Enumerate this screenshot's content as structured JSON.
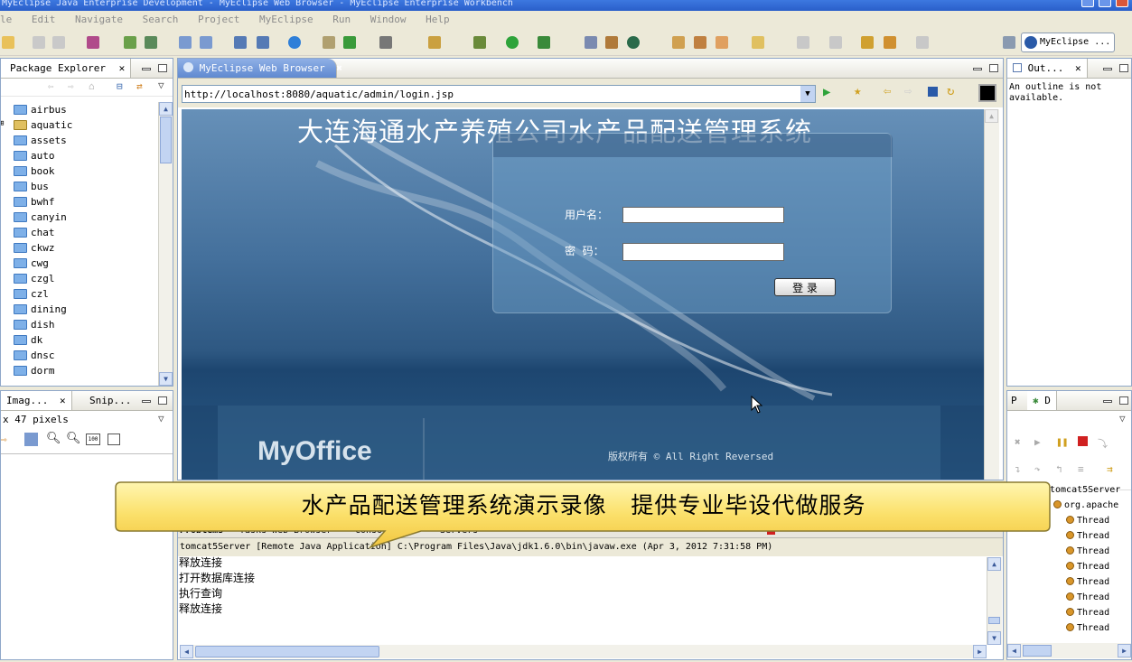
{
  "window": {
    "title": "MyEclipse Java Enterprise Development - MyEclipse Web Browser - MyEclipse Enterprise Workbench"
  },
  "menu": [
    "le",
    "Edit",
    "Navigate",
    "Search",
    "Project",
    "MyEclipse",
    "Run",
    "Window",
    "Help"
  ],
  "perspective": {
    "label": "MyEclipse ..."
  },
  "package_explorer": {
    "tab": "Package Explorer",
    "items": [
      "airbus",
      "aquatic",
      "assets",
      "auto",
      "book",
      "bus",
      "bwhf",
      "canyin",
      "chat",
      "ckwz",
      "cwg",
      "czgl",
      "czl",
      "dining",
      "dish",
      "dk",
      "dnsc",
      "dorm"
    ]
  },
  "image_panel": {
    "tab1": "Imag...",
    "tab2": "Snip...",
    "size_text": "x 47 pixels"
  },
  "browser": {
    "tab": "MyEclipse Web Browser",
    "url": "http://localhost:8080/aquatic/admin/login.jsp",
    "page_title": "大连海通水产养殖公司水产品配送管理系统",
    "username_label": "用户名：",
    "password_label": "密  码：",
    "login_button": "登 录",
    "logo": "MyOffice",
    "copyright": "版权所有 © All Right Reversed"
  },
  "caption_banner": "水产品配送管理系统演示录像   提供专业毕设代做服务",
  "bottom_panel": {
    "tabs": [
      "Problems",
      "Tasks",
      "Web Browser",
      "Console",
      "Servers"
    ],
    "console_header": "tomcat5Server [Remote Java Application] C:\\Program Files\\Java\\jdk1.6.0\\bin\\javaw.exe (Apr 3, 2012 7:31:58 PM)",
    "lines": [
      "释放连接",
      "打开数据库连接",
      "执行查询",
      "释放连接"
    ]
  },
  "outline": {
    "tab": "Out...",
    "message": "An outline is not available."
  },
  "debug": {
    "tab1": "P",
    "tab2": "D",
    "items": [
      "tomcat5Server",
      "org.apache",
      "Thread",
      "Thread",
      "Thread",
      "Thread",
      "Thread",
      "Thread",
      "Thread",
      "Thread",
      "Thread"
    ]
  }
}
